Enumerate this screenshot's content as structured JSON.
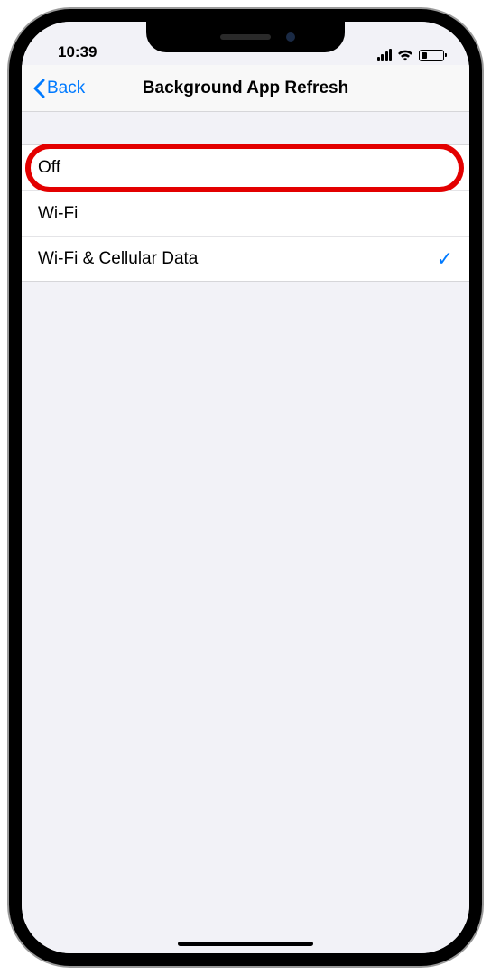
{
  "status": {
    "time": "10:39"
  },
  "nav": {
    "back_label": "Back",
    "title": "Background App Refresh"
  },
  "options": [
    {
      "label": "Off",
      "selected": false,
      "highlighted": true
    },
    {
      "label": "Wi-Fi",
      "selected": false,
      "highlighted": false
    },
    {
      "label": "Wi-Fi & Cellular Data",
      "selected": true,
      "highlighted": false
    }
  ],
  "colors": {
    "accent": "#007aff",
    "highlight": "#e30000",
    "background": "#f2f2f7"
  }
}
